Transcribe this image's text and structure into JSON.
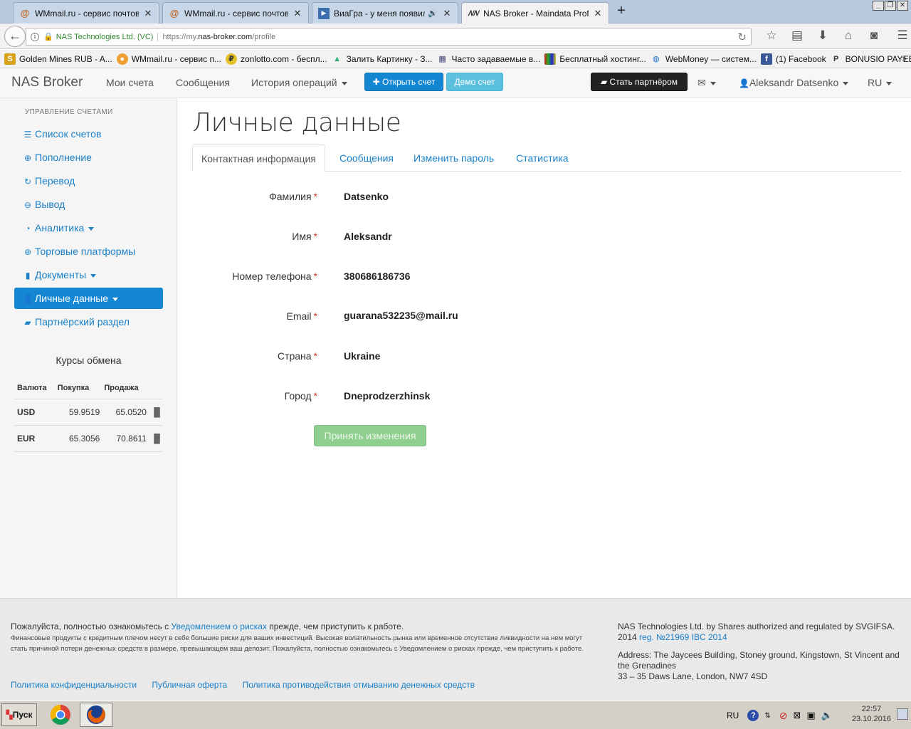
{
  "browser": {
    "tabs": [
      {
        "title": "WMmail.ru - сервис почтовы...",
        "icon": "at-icon"
      },
      {
        "title": "WMmail.ru - сервис почтовы...",
        "icon": "at-icon"
      },
      {
        "title": "ВиаГра - у меня появилс...",
        "icon": "play-icon"
      },
      {
        "title": "NAS Broker - Maindata Profile",
        "icon": "nas-icon"
      }
    ],
    "url_company": "NAS Technologies Ltd. (VC)",
    "url_prefix": "https://my.",
    "url_domain": "nas-broker.com",
    "url_path": "/profile",
    "bookmarks": [
      "Golden Mines RUB - A...",
      "WMmail.ru - сервис п...",
      "zonlotto.com - беспл...",
      "Залить Картинку - З...",
      "Часто задаваемые в...",
      "Бесплатный хостинг...",
      "WebMoney — систем...",
      "(1) Facebook",
      "BONUSIO PAYEER BO..."
    ],
    "bookmarks_more": "»"
  },
  "site": {
    "brand": "NAS Broker",
    "menu": {
      "accounts": "Мои счета",
      "messages": "Сообщения",
      "history": "История операций",
      "open_account": "Открыть счет",
      "demo": "Демо счет",
      "partner": "Стать партнёром",
      "user": "Aleksandr Datsenko",
      "lang": "RU"
    }
  },
  "sidebar": {
    "heading": "УПРАВЛЕНИЕ СЧЕТАМИ",
    "items": [
      {
        "label": "Список счетов",
        "icon": "list-icon"
      },
      {
        "label": "Пополнение",
        "icon": "plus-circle-icon"
      },
      {
        "label": "Перевод",
        "icon": "refresh-icon"
      },
      {
        "label": "Вывод",
        "icon": "minus-circle-icon"
      },
      {
        "label": "Аналитика",
        "icon": "dashboard-icon"
      },
      {
        "label": "Торговые платформы",
        "icon": "download-icon"
      },
      {
        "label": "Документы",
        "icon": "file-icon"
      },
      {
        "label": "Личные данные",
        "icon": "user-icon"
      },
      {
        "label": "Партнёрский раздел",
        "icon": "briefcase-icon"
      }
    ],
    "rates": {
      "title": "Курсы обмена",
      "headers": [
        "Валюта",
        "Покупка",
        "Продажа"
      ],
      "rows": [
        {
          "currency": "USD",
          "buy": "59.9519",
          "sell": "65.0520"
        },
        {
          "currency": "EUR",
          "buy": "65.3056",
          "sell": "70.8611"
        }
      ]
    }
  },
  "main": {
    "title": "Личные данные",
    "tabs": [
      "Контактная информация",
      "Сообщения",
      "Изменить пароль",
      "Статистика"
    ],
    "fields": [
      {
        "label": "Фамилия",
        "value": "Datsenko"
      },
      {
        "label": "Имя",
        "value": "Aleksandr"
      },
      {
        "label": "Номер телефона",
        "value": "380686186736"
      },
      {
        "label": "Email",
        "value": "guarana532235@mail.ru"
      },
      {
        "label": "Страна",
        "value": "Ukraine"
      },
      {
        "label": "Город",
        "value": "Dneprodzerzhinsk"
      }
    ],
    "required_mark": "*",
    "save_button": "Принять изменения"
  },
  "footer": {
    "warn_pre": "Пожалуйста, полностью ознакомьтесь с ",
    "warn_link": "Уведомлением о рисках",
    "warn_post": " прежде, чем приступить к работе.",
    "small": "Финансовые продукты с кредитным плечом несут в себе большие риски для ваших инвестиций. Высокая волатильность рынка или временное отсутствие ликвидности на нем могут стать причиной потери денежных средств в размере, превышающем ваш депозит. Пожалуйста, полностью ознакомьтесь с Уведомлением о рисках прежде, чем приступить к работе.",
    "links": [
      "Политика конфиденциальности",
      "Публичная оферта",
      "Политика противодействия отмыванию денежных средств"
    ],
    "right_line1": "NAS Technologies Ltd. by Shares authorized and regulated by SVGIFSA.",
    "right_line2_pre": "2014 ",
    "right_line2_link": "reg. №21969 IBC 2014",
    "address": "Address: The Jaycees Building, Stoney ground, Kingstown, St Vincent and the Grenadines",
    "address2": "33 – 35 Daws Lane, London, NW7 4SD"
  },
  "taskbar": {
    "start": "Пуск",
    "lang": "RU",
    "time": "22:57",
    "date": "23.10.2016"
  }
}
